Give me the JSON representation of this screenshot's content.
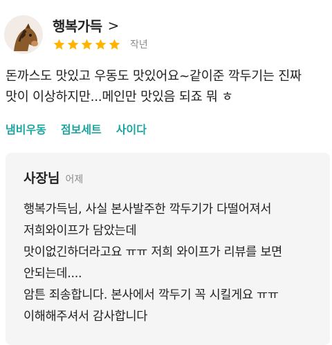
{
  "review": {
    "author": "행복가득",
    "chevron": ">",
    "rating": 5,
    "time": "작년",
    "lines": [
      "돈까스도 맛있고 우동도 맛있어요~같이준 깍두기는 진짜",
      "맛이 이상하지만...메인만 맛있음 되죠 뭐 ㅎ"
    ],
    "tags": [
      "냄비우동",
      "점보세트",
      "사이다"
    ],
    "colors": {
      "star": "#ffb400",
      "tag": "#1ba5a0"
    }
  },
  "reply": {
    "owner": "사장님",
    "time": "어제",
    "lines": [
      "행복가득님, 사실 본사발주한 깍두기가 다떨어져서",
      "저희와이프가 담았는데",
      "맛이없긴하더라고요 ㅠㅠ 저희 와이프가 리뷰를 보면",
      "안되는데....",
      "암튼 죄송합니다. 본사에서 깍두기 꼭 시킬게요 ㅠㅠ",
      "이해해주셔서 감사합니다"
    ]
  }
}
